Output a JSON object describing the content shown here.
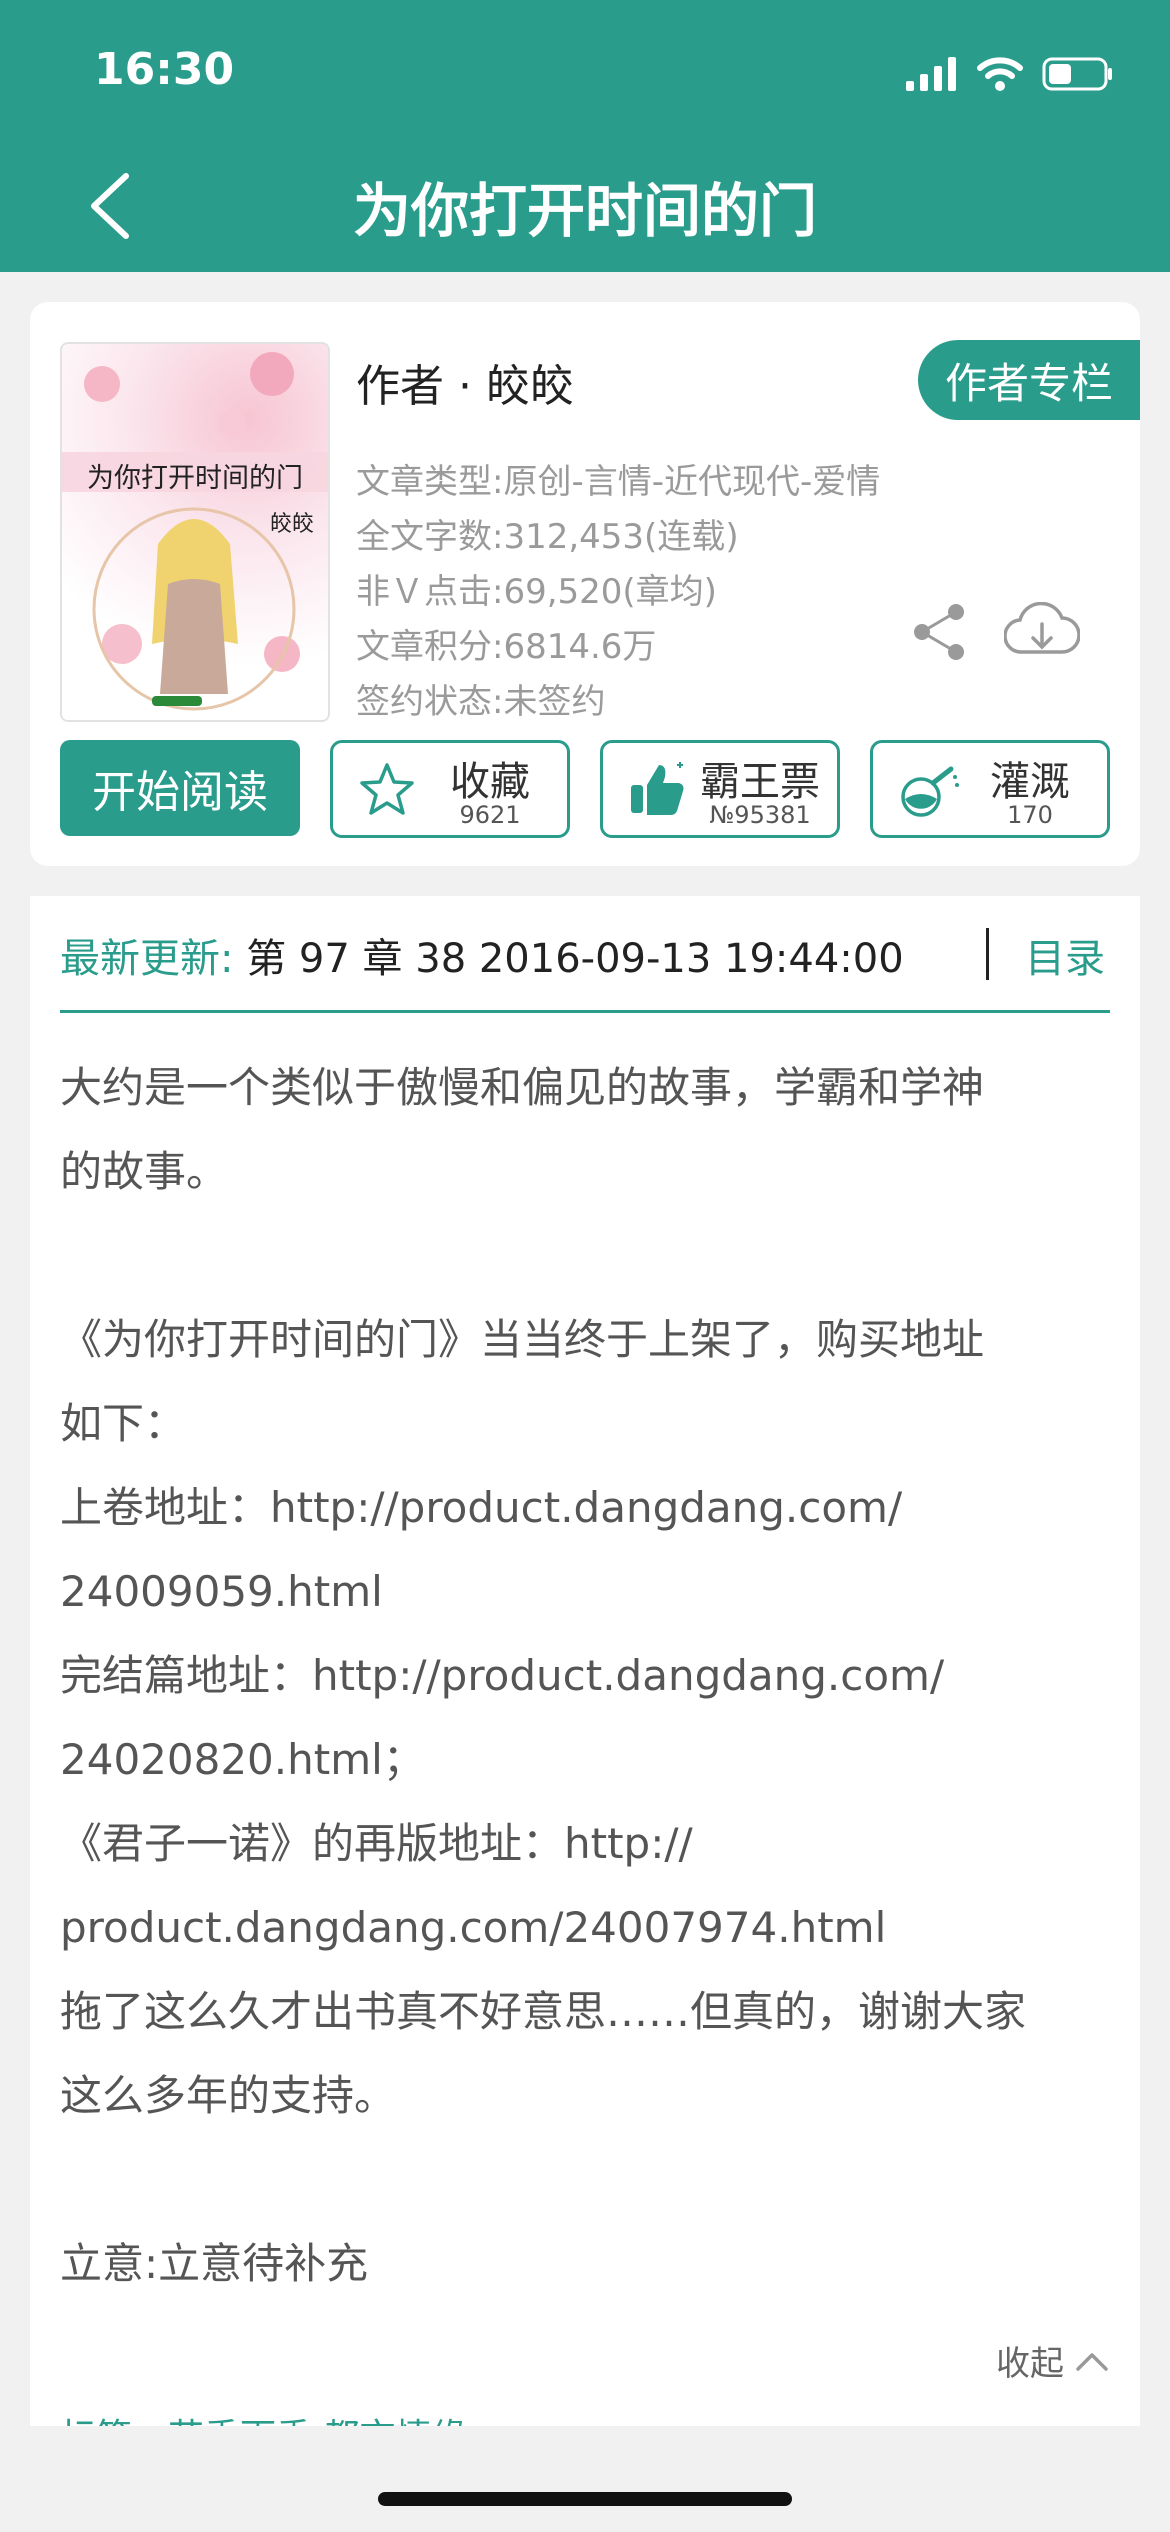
{
  "status": {
    "time": "16:30"
  },
  "nav": {
    "title": "为你打开时间的门"
  },
  "book": {
    "cover_title": "为你打开时间的门",
    "cover_author": "皎皎",
    "author": "作者 · 皎皎",
    "author_column_btn": "作者专栏",
    "meta": [
      "文章类型:原创-言情-近代现代-爱情",
      "全文字数:312,453(连载)",
      "非Ｖ点击:69,520(章均)",
      "文章积分:6814.6万",
      "签约状态:未签约"
    ]
  },
  "actions": {
    "read": "开始阅读",
    "collect": {
      "label": "收藏",
      "count": "9621"
    },
    "ticket": {
      "label": "霸王票",
      "count": "№95381"
    },
    "water": {
      "label": "灌溉",
      "count": "170"
    }
  },
  "update": {
    "label": "最新更新:",
    "text": " 第 97 章 38 2016-09-13 19:44:00",
    "toc": "目录"
  },
  "intro_lines": [
    "大约是一个类似于傲慢和偏见的故事，学霸和学神",
    "的故事。",
    "",
    "《为你打开时间的门》当当终于上架了，购买地址",
    "如下：",
    "上卷地址：http://product.dangdang.com/",
    "24009059.html",
    "完结篇地址：http://product.dangdang.com/",
    "24020820.html；",
    "《君子一诺》的再版地址：http://",
    "product.dangdang.com/24007974.html",
    "拖了这么久才出书真不好意思……但真的，谢谢大家",
    "这么多年的支持。",
    "",
    "立意:立意待补充"
  ],
  "collapse": "收起",
  "tags": "标签：花季雨季 都市情缘",
  "colors": {
    "accent": "#2a9c8c"
  }
}
